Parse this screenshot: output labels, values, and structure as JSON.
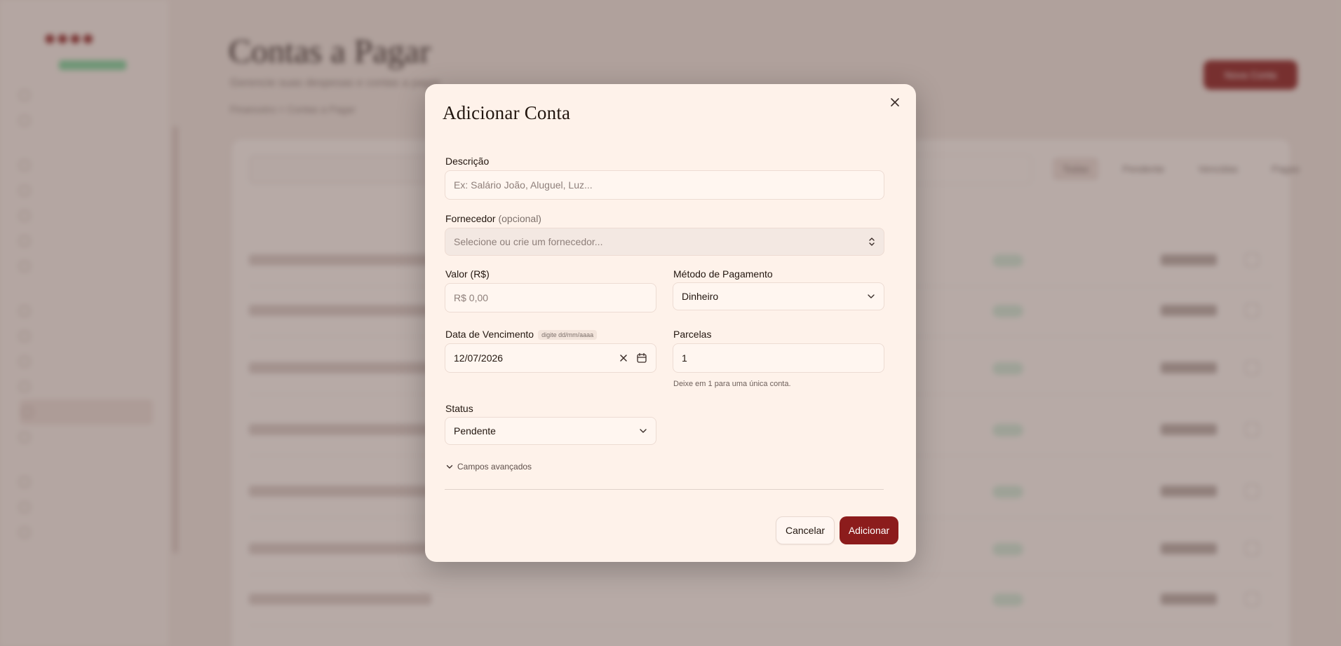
{
  "background": {
    "page_title": "Contas a Pagar",
    "page_subtitle": "Gerencie suas despesas e contas a pagar",
    "breadcrumb": "Financeiro  >  Contas a Pagar",
    "primary_button": "Nova Conta",
    "tabs": [
      "Todas",
      "Pendente",
      "Vencidas",
      "Pagas"
    ]
  },
  "modal": {
    "title": "Adicionar Conta",
    "descricao": {
      "label": "Descrição",
      "placeholder": "Ex: Salário João, Aluguel, Luz..."
    },
    "fornecedor": {
      "label": "Fornecedor",
      "optional_label": "(opcional)",
      "placeholder": "Selecione ou crie um fornecedor..."
    },
    "valor": {
      "label": "Valor (R$)",
      "placeholder": "R$ 0,00"
    },
    "metodo_pagamento": {
      "label": "Método de Pagamento",
      "value": "Dinheiro"
    },
    "data_vencimento": {
      "label": "Data de Vencimento",
      "hint": "digite dd/mm/aaaa",
      "value": "12/07/2026"
    },
    "parcelas": {
      "label": "Parcelas",
      "value": "1",
      "note": "Deixe em 1 para uma única conta."
    },
    "status": {
      "label": "Status",
      "value": "Pendente"
    },
    "advanced_toggle": "Campos avançados",
    "buttons": {
      "cancel": "Cancelar",
      "submit": "Adicionar"
    }
  },
  "icons": {
    "close": "close-icon",
    "select_updown": "chevrons-up-down-icon",
    "dropdown": "chevron-down-icon",
    "clear": "x-icon",
    "calendar": "calendar-icon"
  },
  "colors": {
    "accent": "#8c1c1c",
    "modal_bg": "#fef2ea"
  }
}
